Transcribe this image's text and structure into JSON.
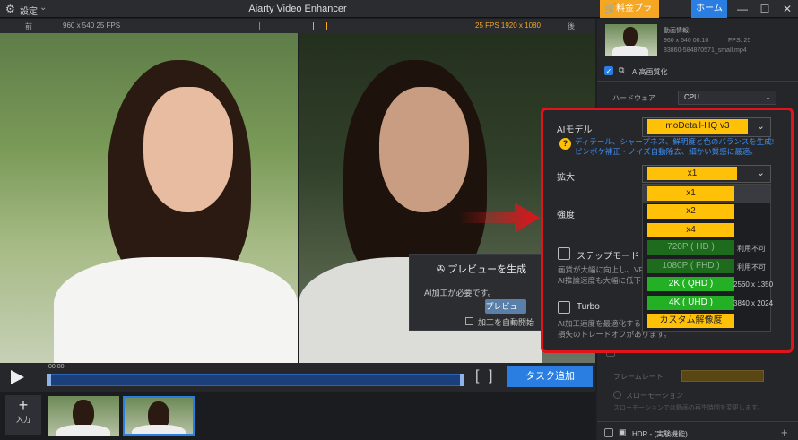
{
  "titlebar": {
    "settings_label": "設定",
    "app_title": "Aiarty Video Enhancer",
    "pricing_label": "料金プラン",
    "home_label": "ホーム"
  },
  "preview": {
    "before_label": "前",
    "before_info": "960 x 540  25 FPS",
    "after_info": "25 FPS   1920 x 1080",
    "after_label": "後",
    "panel_title": "プレビューを生成",
    "need_ai_text": "AI加工が必要です。",
    "preview_button": "プレビュー",
    "auto_start_label": "加工を自動開始"
  },
  "timeline": {
    "time": "00:00",
    "task_button": "タスク追加"
  },
  "input": {
    "add_label": "入力"
  },
  "sidebar": {
    "video_info_label": "動画情報:",
    "video_resolution": "960 x 540  00:10",
    "video_fps": "FPS: 25",
    "video_file": "83860-584870571_small.mp4",
    "ai_enhance_label": "AI高画質化",
    "hardware_label": "ハードウェア",
    "hardware_value": "CPU",
    "framerate_label": "フレームレート",
    "slowmo_label": "スローモーション",
    "slowmo_desc": "スローモーションでは動画の再生時間を変更します。",
    "hdr_label": "HDR - (実験機能)"
  },
  "settings": {
    "ai_model_label": "AIモデル",
    "ai_model_value": "moDetail-HQ  v3",
    "description_line1": "ディテール、シャープネス、鮮明度と色のバランスを生成!",
    "description_line2": "ピンボケ補正・ノイズ自動除去、細かい質感に最適。",
    "scale_label": "拡大",
    "scale_value": "x1",
    "strength_label": "強度",
    "stepmode_label": "ステップモード",
    "stepmode_desc1": "画質が大幅に向上し、VR",
    "stepmode_desc2": "AI推論速度も大幅に低下",
    "turbo_label": "Turbo",
    "turbo_desc1": "AI加工速度を最適化する",
    "turbo_desc2": "損失のトレードオフがあります。",
    "options": [
      {
        "label": "x1",
        "side": ""
      },
      {
        "label": "x2",
        "side": ""
      },
      {
        "label": "x4",
        "side": ""
      },
      {
        "label": "720P ( HD )",
        "side": "利用不可"
      },
      {
        "label": "1080P ( FHD )",
        "side": "利用不可"
      },
      {
        "label": "2K ( QHD )",
        "side": "2560 x 1350"
      },
      {
        "label": "4K ( UHD )",
        "side": "3840 x 2024"
      },
      {
        "label": "カスタム解像度",
        "side": ""
      }
    ]
  },
  "colors": {
    "accent_blue": "#2a7de1",
    "highlight_red": "#e0141a",
    "option_yellow": "#ffc107",
    "option_green": "#24b024"
  }
}
